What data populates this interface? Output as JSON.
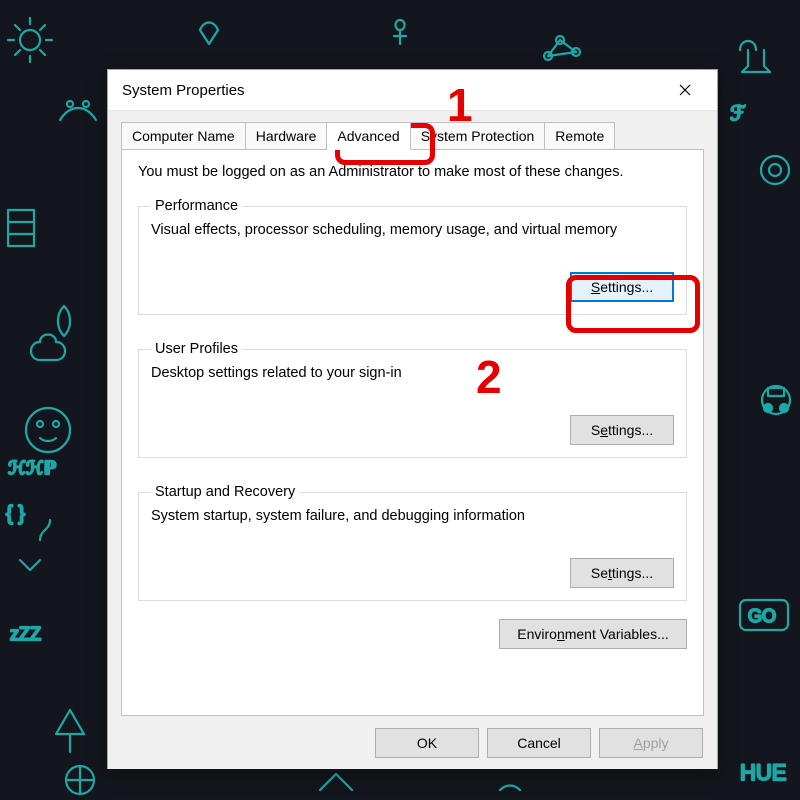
{
  "window": {
    "title": "System Properties"
  },
  "tabs": {
    "computer_name": "Computer Name",
    "hardware": "Hardware",
    "advanced": "Advanced",
    "system_protection": "System Protection",
    "remote": "Remote",
    "active": "advanced"
  },
  "advanced": {
    "admin_note": "You must be logged on as an Administrator to make most of these changes.",
    "performance": {
      "legend": "Performance",
      "desc": "Visual effects, processor scheduling, memory usage, and virtual memory",
      "button": "Settings..."
    },
    "user_profiles": {
      "legend": "User Profiles",
      "desc": "Desktop settings related to your sign-in",
      "button": "Settings..."
    },
    "startup": {
      "legend": "Startup and Recovery",
      "desc": "System startup, system failure, and debugging information",
      "button": "Settings..."
    },
    "env_button": "Environment Variables..."
  },
  "footer": {
    "ok": "OK",
    "cancel": "Cancel",
    "apply": "Apply"
  },
  "annotations": {
    "label1": "1",
    "label2": "2"
  }
}
